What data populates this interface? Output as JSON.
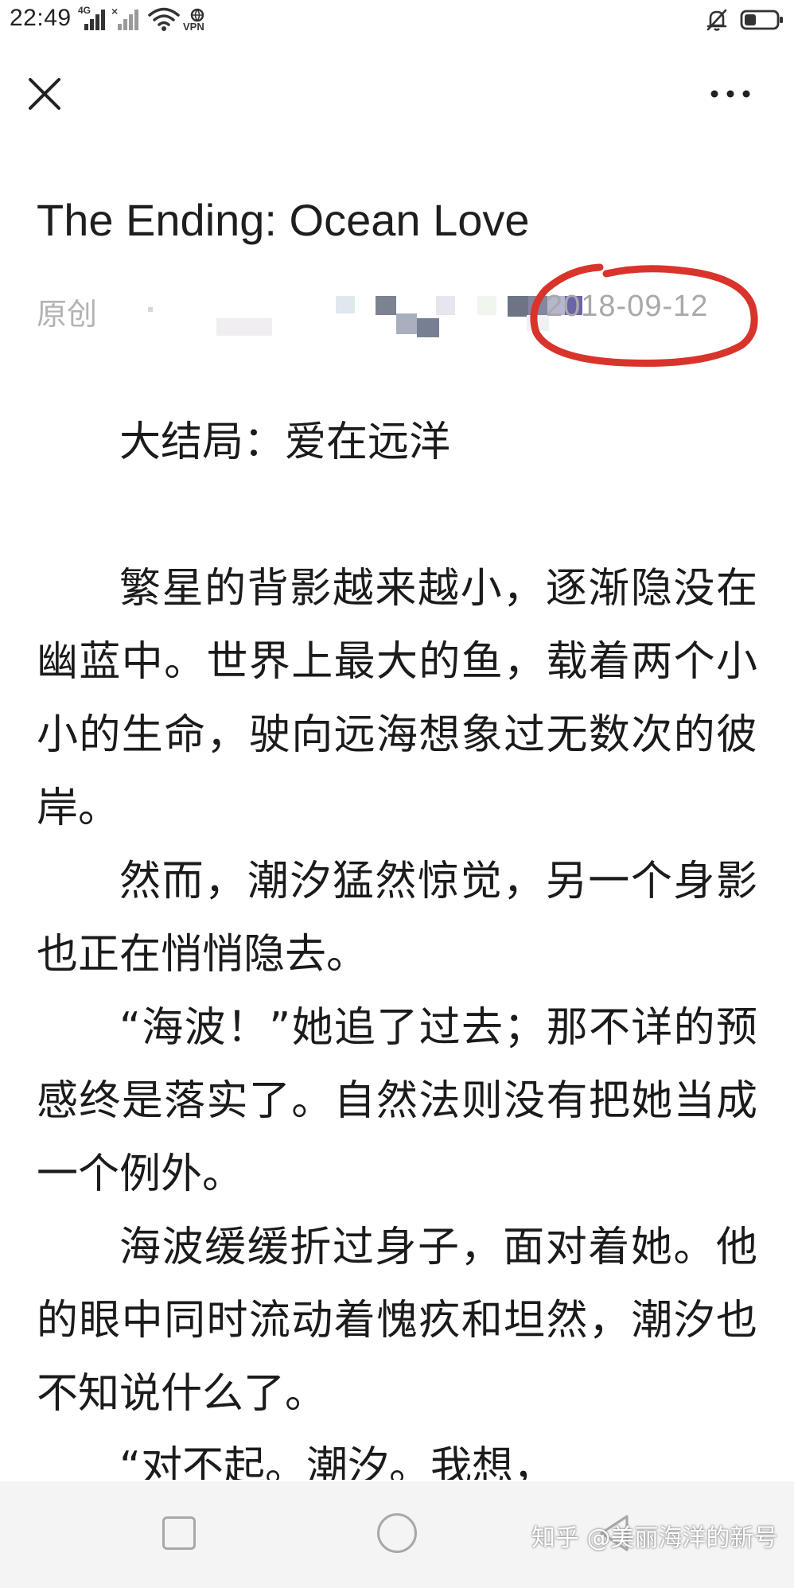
{
  "status_bar": {
    "time": "22:49",
    "network_label": "4G",
    "network_label_2": "×",
    "vpn_label": "VPN",
    "icons": [
      "signal-icon",
      "signal-icon",
      "wifi-icon",
      "vpn-icon",
      "bell-off-icon",
      "battery-icon"
    ]
  },
  "nav": {
    "close_icon": "close-icon",
    "more_icon": "more-icon"
  },
  "article": {
    "title": "The Ending: Ocean Love",
    "original_tag": "原创",
    "publish_date": "2018-09-12",
    "subtitle": "大结局：爱在远洋",
    "paragraphs": [
      "繁星的背影越来越小，逐渐隐没在幽蓝中。世界上最大的鱼，载着两个小小的生命，驶向远海想象过无数次的彼岸。",
      "然而，潮汐猛然惊觉，另一个身影也正在悄悄隐去。",
      "“海波！”她追了过去；那不详的预感终是落实了。自然法则没有把她当成一个例外。",
      "海波缓缓折过身子，面对着她。他的眼中同时流动着愧疚和坦然，潮汐也不知说什么了。",
      "“对不起。潮汐。我想，"
    ]
  },
  "annotation": {
    "circle_color": "#d9342b"
  },
  "bottom_nav": {
    "watermark": "知乎 @美丽海洋的新号",
    "icons": [
      "recent-apps-icon",
      "home-icon",
      "back-icon"
    ]
  },
  "colors": {
    "background": "#ffffff",
    "text": "#1b1b1b",
    "meta_text": "#b3b3b3",
    "nav_background": "#f4f4f4"
  }
}
